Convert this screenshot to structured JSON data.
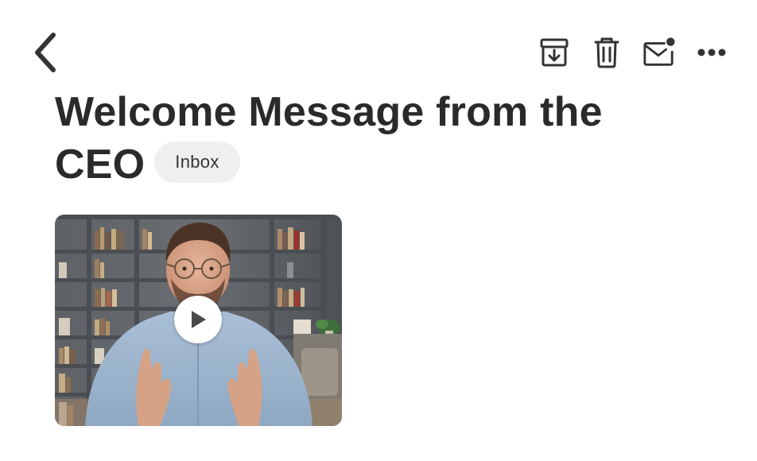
{
  "toolbar": {
    "back_icon": "chevron-left-icon",
    "actions": [
      {
        "name": "archive",
        "icon": "archive-box-icon"
      },
      {
        "name": "delete",
        "icon": "trash-icon"
      },
      {
        "name": "mark-unread",
        "icon": "mail-unread-icon"
      },
      {
        "name": "more",
        "icon": "more-horizontal-icon"
      }
    ],
    "icon_color": "#333333"
  },
  "message": {
    "subject": "Welcome Message from the CEO",
    "label": "Inbox",
    "label_bg": "#efefef"
  },
  "attachment": {
    "type": "video",
    "thumbnail": "man-with-glasses-in-blue-shirt-in-front-of-bookshelf",
    "play_icon": "play-icon"
  }
}
